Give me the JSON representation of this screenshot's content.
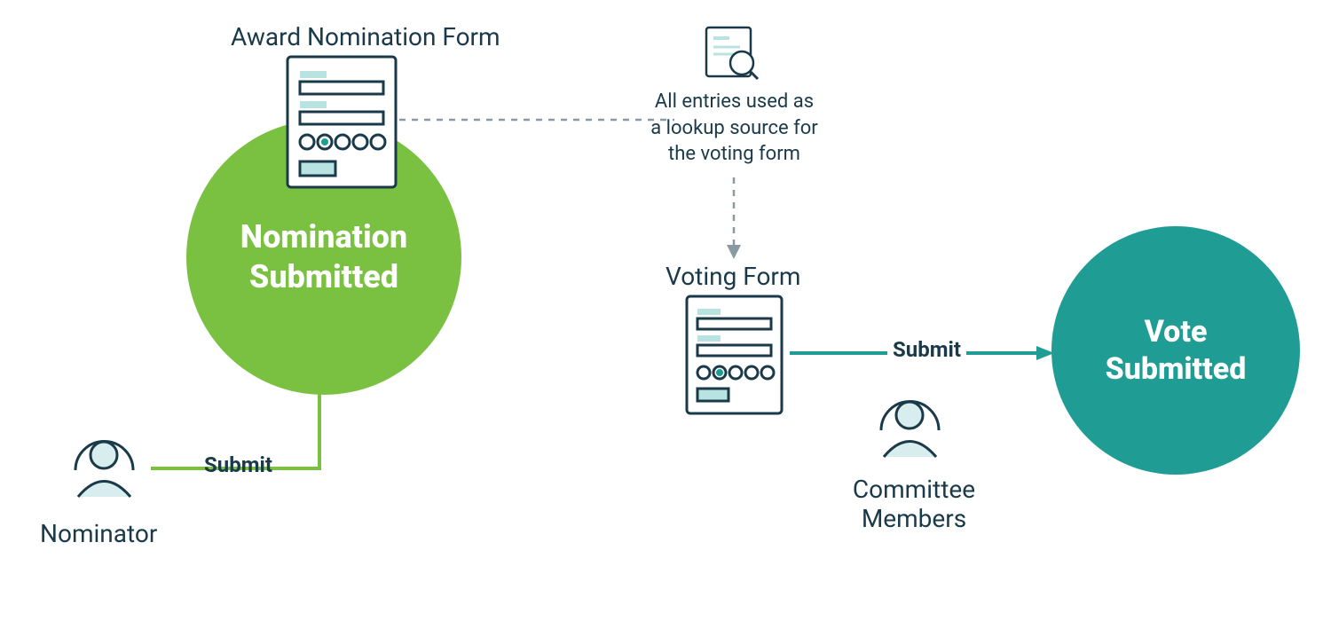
{
  "colors": {
    "dark": "#1a3a4a",
    "teal": "#1f9d95",
    "teal_dark": "#1f9d95",
    "green": "#7ac142",
    "light_teal": "#d8eeee",
    "gray_dash": "#8a9aa3"
  },
  "labels": {
    "award_form_title": "Award Nomination Form",
    "lookup_note_l1": "All entries used as",
    "lookup_note_l2": "a lookup source for",
    "lookup_note_l3": "the voting form",
    "voting_form_title": "Voting Form",
    "nominator": "Nominator",
    "committee_l1": "Committee",
    "committee_l2": "Members",
    "submit1": "Submit",
    "submit2": "Submit"
  },
  "circles": {
    "nomination_l1": "Nomination",
    "nomination_l2": "Submitted",
    "vote_l1": "Vote",
    "vote_l2": "Submitted"
  }
}
